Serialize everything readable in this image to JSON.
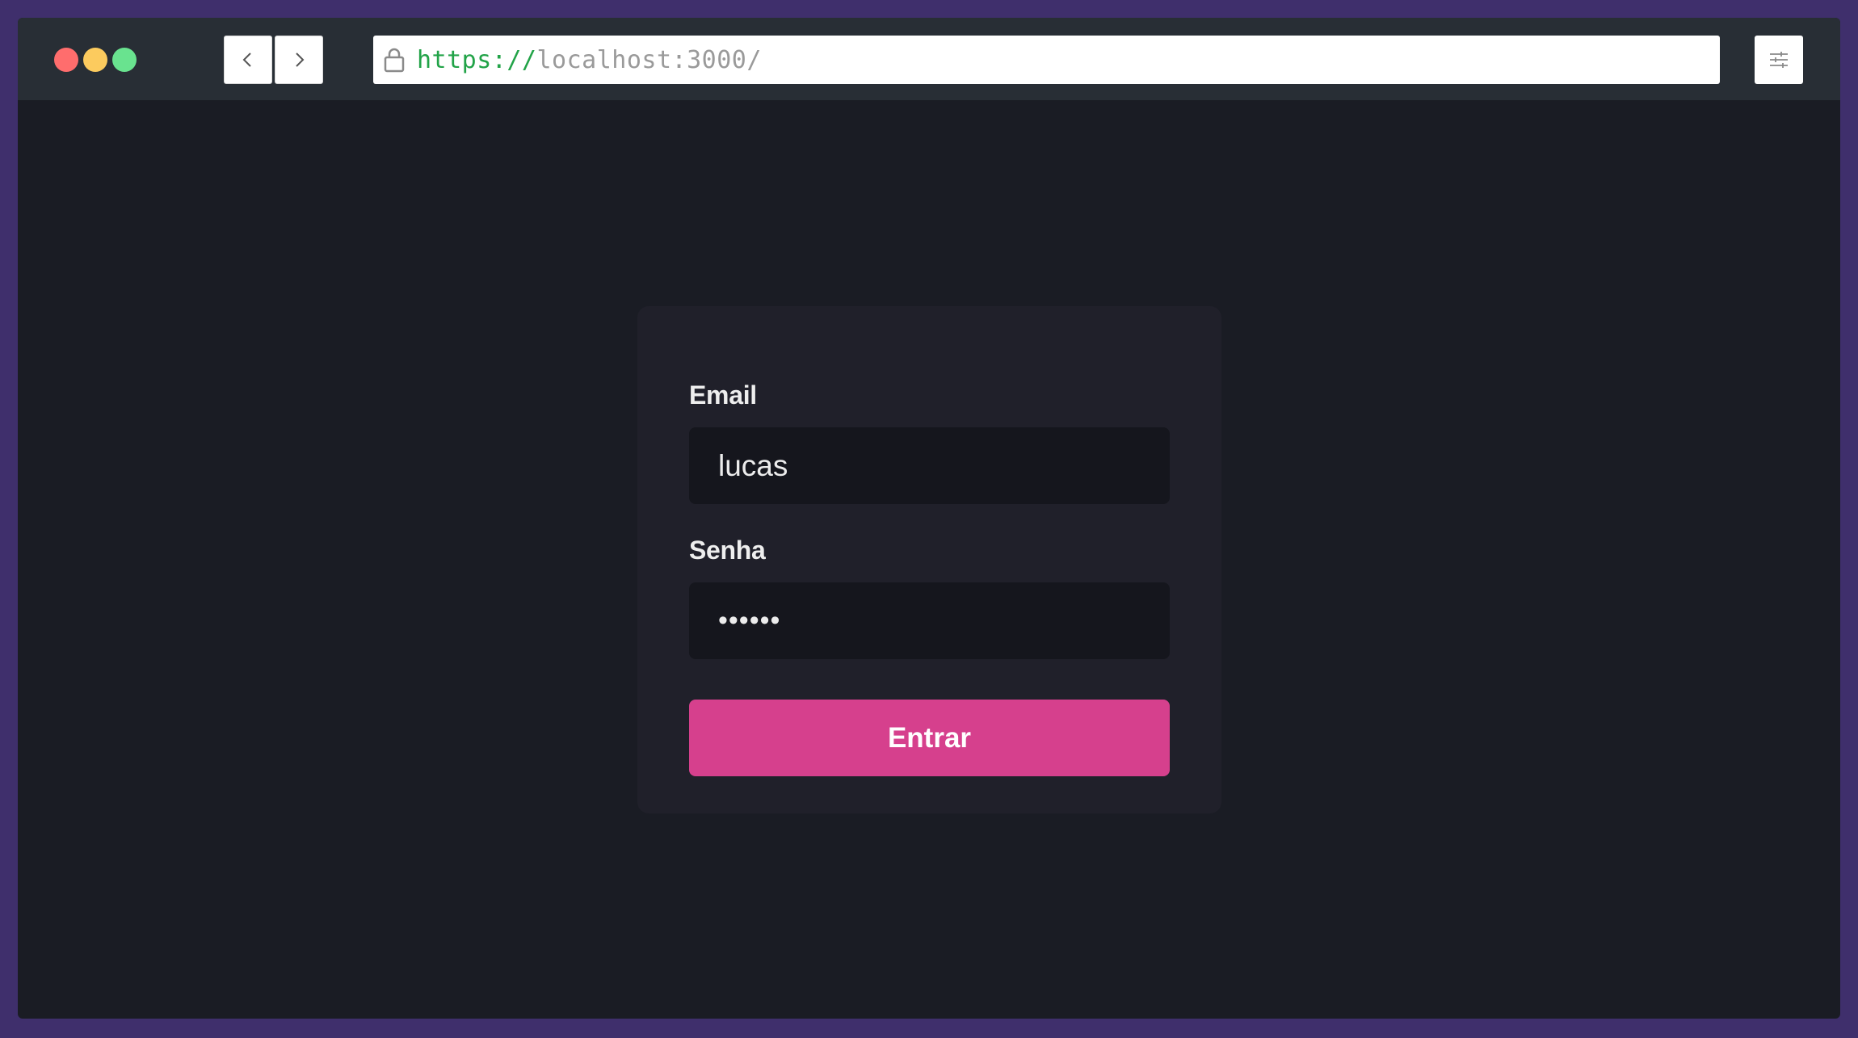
{
  "browser": {
    "url_protocol": "https://",
    "url_host": "localhost:3000/"
  },
  "form": {
    "email_label": "Email",
    "email_value": "lucas",
    "password_label": "Senha",
    "password_value": "••••••",
    "submit_label": "Entrar"
  },
  "colors": {
    "background_outer": "#3f2f6c",
    "page_background": "#1a1c24",
    "card_background": "#20202a",
    "input_background": "#15161d",
    "accent": "#d6408d",
    "url_protocol": "#22a348"
  },
  "icons": [
    "lock-icon",
    "chevron-left-icon",
    "chevron-right-icon",
    "sliders-icon"
  ]
}
